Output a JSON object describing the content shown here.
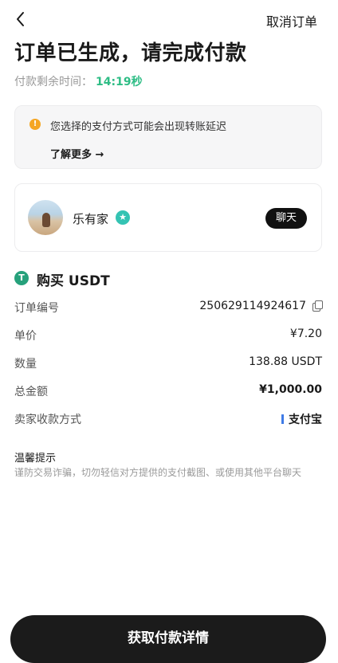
{
  "header": {
    "back_icon": "chevron-left-icon",
    "cancel_label": "取消订单"
  },
  "title": "订单已生成，请完成付款",
  "timer": {
    "label": "付款剩余时间：",
    "value": "14:19秒",
    "accent_color": "#2ebd85"
  },
  "notice": {
    "icon": "warning-icon",
    "icon_glyph": "!",
    "message": "您选择的支付方式可能会出现转账延迟",
    "link_label": "了解更多 →"
  },
  "seller": {
    "name": "乐有家",
    "badge_icon": "verified-star-icon",
    "badge_glyph": "★",
    "chat_label": "聊天"
  },
  "order": {
    "asset_icon_glyph": "T",
    "heading": "购买 USDT",
    "rows": [
      {
        "label": "订单编号",
        "value": "250629114924617"
      },
      {
        "label": "单价",
        "value": "¥7.20"
      },
      {
        "label": "数量",
        "value": "138.88 USDT"
      },
      {
        "label": "总金额",
        "value": "¥1,000.00"
      },
      {
        "label": "卖家收款方式",
        "value": "支付宝"
      }
    ]
  },
  "tips": {
    "title": "温馨提示",
    "body": "谨防交易诈骗，切勿轻信对方提供的支付截图、或使用其他平台聊天"
  },
  "primary_button": "获取付款详情"
}
